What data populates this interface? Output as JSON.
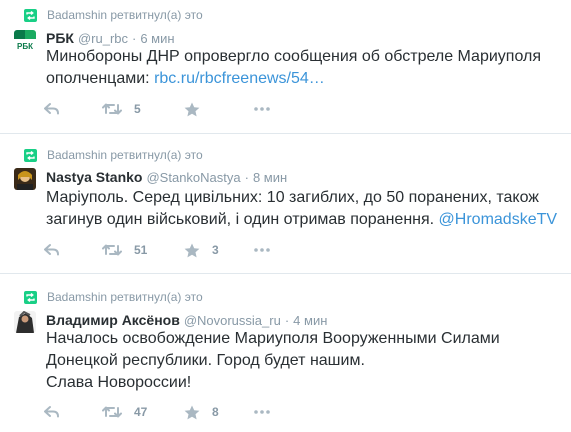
{
  "tweets": [
    {
      "retweeted_by": "Badamshin ретвитнул(а) это",
      "fullname": "РБК",
      "username": "@ru_rbc",
      "separator": "·",
      "time": "6 мин",
      "text_line1": "Минобороны ДНР опровергло сообщения об обстреле Мариуполя",
      "text_line2_prefix": "ополченцами: ",
      "text_link": "rbc.ru/rbcfreenews/54…",
      "retweets": "5",
      "favorites": "",
      "avatar_text": "РБК"
    },
    {
      "retweeted_by": "Badamshin ретвитнул(а) это",
      "fullname": "Nastya Stanko",
      "username": "@StankoNastya",
      "separator": "·",
      "time": "8 мин",
      "text_line1": "Маріуполь. Серед цивільних: 10 загиблих, до 50 поранених, також",
      "text_line2_prefix": "загинув один військовий, і один отримав поранення. ",
      "text_link": "@HromadskeTV",
      "retweets": "51",
      "favorites": "3"
    },
    {
      "retweeted_by": "Badamshin ретвитнул(а) это",
      "fullname": "Владимир Аксёнов",
      "username": "@Novorussia_ru",
      "separator": "·",
      "time": "4 мин",
      "text_line1": "Началось освобождение Мариуполя Вооруженными Силами",
      "text_line2": "Донецкой республики. Город будет нашим.",
      "text_line3": "Слава Новороссии!",
      "retweets": "47",
      "favorites": "8"
    }
  ],
  "colors": {
    "retweet_green": "#19cf86",
    "link_blue": "#3b94d9",
    "muted_gray": "#8899a6",
    "icon_gray": "#aab8c2"
  },
  "icons": {
    "retweet_banner": "retweet-icon",
    "reply": "reply-icon",
    "retweet": "retweet-icon",
    "favorite": "star-icon",
    "more": "more-dots-icon"
  }
}
